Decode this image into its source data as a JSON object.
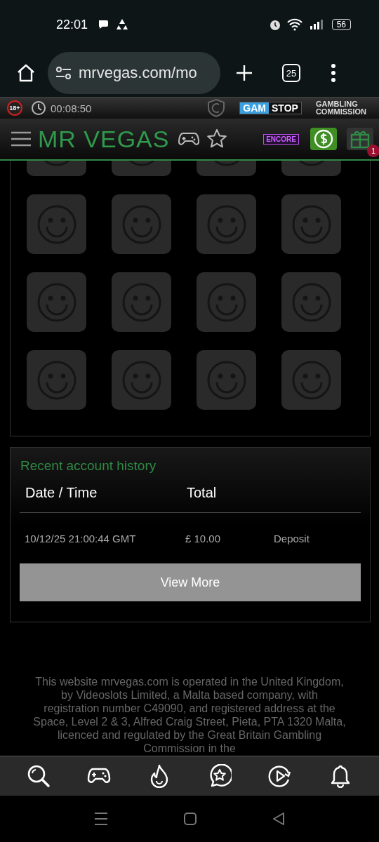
{
  "status_bar": {
    "time": "22:01",
    "battery": "56"
  },
  "browser": {
    "url": "mrvegas.com/mo",
    "tab_count": "25"
  },
  "compliance_strip": {
    "age": "18+",
    "session_timer": "00:08:50",
    "gamstop": [
      "GAM",
      "STOP"
    ],
    "commission": [
      "GAMBLING",
      "COMMISSION"
    ]
  },
  "header": {
    "logo": "MR VEGAS",
    "encore": "ENCORE",
    "gift_badge": "1"
  },
  "games": [
    {
      "kind": "placeholder"
    },
    {
      "kind": "placeholder"
    },
    {
      "kind": "placeholder"
    },
    {
      "kind": "placeholder"
    },
    {
      "kind": "placeholder"
    },
    {
      "kind": "placeholder"
    },
    {
      "kind": "placeholder"
    },
    {
      "kind": "placeholder"
    },
    {
      "kind": "placeholder"
    },
    {
      "kind": "placeholder"
    },
    {
      "kind": "placeholder"
    },
    {
      "kind": "placeholder"
    },
    {
      "kind": "placeholder"
    },
    {
      "kind": "placeholder"
    },
    {
      "kind": "placeholder"
    },
    {
      "kind": "placeholder"
    }
  ],
  "history": {
    "title": "Recent account history",
    "columns": [
      "Date / Time",
      "Total"
    ],
    "rows": [
      {
        "date": "10/12/25 21:00:44 GMT",
        "total": "£ 10.00",
        "type": "Deposit"
      }
    ],
    "button": "View More"
  },
  "footer": "This website mrvegas.com is operated in the United Kingdom, by Videoslots Limited, a Malta based company, with registration number C49090, and registered address at the Space, Level 2 & 3, Alfred Craig Street, Pieta, PTA 1320 Malta, licenced and regulated by the Great Britain Gambling Commission in the",
  "bottom_nav": [
    {
      "kind": "search"
    },
    {
      "kind": "games"
    },
    {
      "kind": "hot"
    },
    {
      "kind": "favourites"
    },
    {
      "kind": "replay"
    },
    {
      "kind": "notifications"
    }
  ]
}
